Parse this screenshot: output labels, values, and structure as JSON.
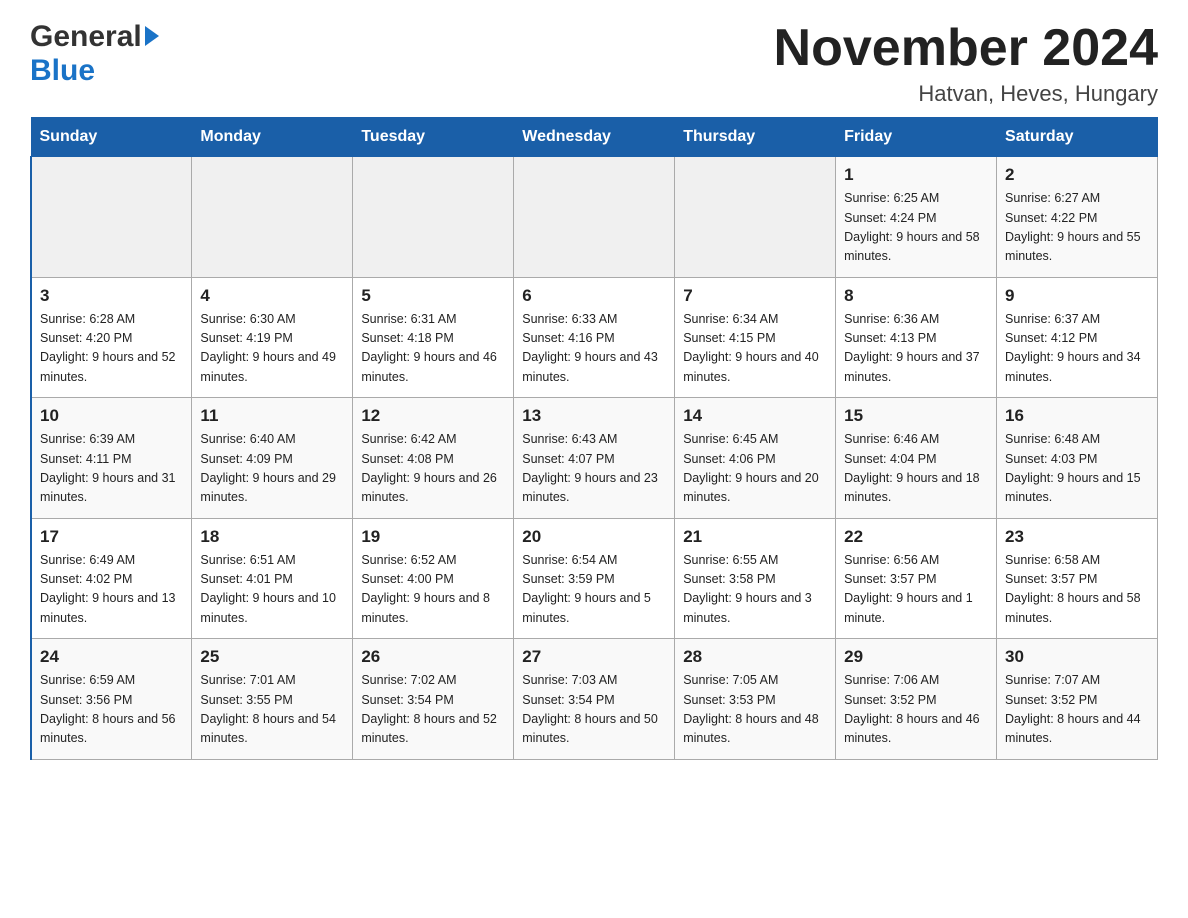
{
  "logo": {
    "general": "General",
    "blue": "Blue"
  },
  "title": {
    "month_year": "November 2024",
    "location": "Hatvan, Heves, Hungary"
  },
  "days_header": [
    "Sunday",
    "Monday",
    "Tuesday",
    "Wednesday",
    "Thursday",
    "Friday",
    "Saturday"
  ],
  "weeks": [
    [
      {
        "day": "",
        "info": ""
      },
      {
        "day": "",
        "info": ""
      },
      {
        "day": "",
        "info": ""
      },
      {
        "day": "",
        "info": ""
      },
      {
        "day": "",
        "info": ""
      },
      {
        "day": "1",
        "info": "Sunrise: 6:25 AM\nSunset: 4:24 PM\nDaylight: 9 hours and 58 minutes."
      },
      {
        "day": "2",
        "info": "Sunrise: 6:27 AM\nSunset: 4:22 PM\nDaylight: 9 hours and 55 minutes."
      }
    ],
    [
      {
        "day": "3",
        "info": "Sunrise: 6:28 AM\nSunset: 4:20 PM\nDaylight: 9 hours and 52 minutes."
      },
      {
        "day": "4",
        "info": "Sunrise: 6:30 AM\nSunset: 4:19 PM\nDaylight: 9 hours and 49 minutes."
      },
      {
        "day": "5",
        "info": "Sunrise: 6:31 AM\nSunset: 4:18 PM\nDaylight: 9 hours and 46 minutes."
      },
      {
        "day": "6",
        "info": "Sunrise: 6:33 AM\nSunset: 4:16 PM\nDaylight: 9 hours and 43 minutes."
      },
      {
        "day": "7",
        "info": "Sunrise: 6:34 AM\nSunset: 4:15 PM\nDaylight: 9 hours and 40 minutes."
      },
      {
        "day": "8",
        "info": "Sunrise: 6:36 AM\nSunset: 4:13 PM\nDaylight: 9 hours and 37 minutes."
      },
      {
        "day": "9",
        "info": "Sunrise: 6:37 AM\nSunset: 4:12 PM\nDaylight: 9 hours and 34 minutes."
      }
    ],
    [
      {
        "day": "10",
        "info": "Sunrise: 6:39 AM\nSunset: 4:11 PM\nDaylight: 9 hours and 31 minutes."
      },
      {
        "day": "11",
        "info": "Sunrise: 6:40 AM\nSunset: 4:09 PM\nDaylight: 9 hours and 29 minutes."
      },
      {
        "day": "12",
        "info": "Sunrise: 6:42 AM\nSunset: 4:08 PM\nDaylight: 9 hours and 26 minutes."
      },
      {
        "day": "13",
        "info": "Sunrise: 6:43 AM\nSunset: 4:07 PM\nDaylight: 9 hours and 23 minutes."
      },
      {
        "day": "14",
        "info": "Sunrise: 6:45 AM\nSunset: 4:06 PM\nDaylight: 9 hours and 20 minutes."
      },
      {
        "day": "15",
        "info": "Sunrise: 6:46 AM\nSunset: 4:04 PM\nDaylight: 9 hours and 18 minutes."
      },
      {
        "day": "16",
        "info": "Sunrise: 6:48 AM\nSunset: 4:03 PM\nDaylight: 9 hours and 15 minutes."
      }
    ],
    [
      {
        "day": "17",
        "info": "Sunrise: 6:49 AM\nSunset: 4:02 PM\nDaylight: 9 hours and 13 minutes."
      },
      {
        "day": "18",
        "info": "Sunrise: 6:51 AM\nSunset: 4:01 PM\nDaylight: 9 hours and 10 minutes."
      },
      {
        "day": "19",
        "info": "Sunrise: 6:52 AM\nSunset: 4:00 PM\nDaylight: 9 hours and 8 minutes."
      },
      {
        "day": "20",
        "info": "Sunrise: 6:54 AM\nSunset: 3:59 PM\nDaylight: 9 hours and 5 minutes."
      },
      {
        "day": "21",
        "info": "Sunrise: 6:55 AM\nSunset: 3:58 PM\nDaylight: 9 hours and 3 minutes."
      },
      {
        "day": "22",
        "info": "Sunrise: 6:56 AM\nSunset: 3:57 PM\nDaylight: 9 hours and 1 minute."
      },
      {
        "day": "23",
        "info": "Sunrise: 6:58 AM\nSunset: 3:57 PM\nDaylight: 8 hours and 58 minutes."
      }
    ],
    [
      {
        "day": "24",
        "info": "Sunrise: 6:59 AM\nSunset: 3:56 PM\nDaylight: 8 hours and 56 minutes."
      },
      {
        "day": "25",
        "info": "Sunrise: 7:01 AM\nSunset: 3:55 PM\nDaylight: 8 hours and 54 minutes."
      },
      {
        "day": "26",
        "info": "Sunrise: 7:02 AM\nSunset: 3:54 PM\nDaylight: 8 hours and 52 minutes."
      },
      {
        "day": "27",
        "info": "Sunrise: 7:03 AM\nSunset: 3:54 PM\nDaylight: 8 hours and 50 minutes."
      },
      {
        "day": "28",
        "info": "Sunrise: 7:05 AM\nSunset: 3:53 PM\nDaylight: 8 hours and 48 minutes."
      },
      {
        "day": "29",
        "info": "Sunrise: 7:06 AM\nSunset: 3:52 PM\nDaylight: 8 hours and 46 minutes."
      },
      {
        "day": "30",
        "info": "Sunrise: 7:07 AM\nSunset: 3:52 PM\nDaylight: 8 hours and 44 minutes."
      }
    ]
  ]
}
